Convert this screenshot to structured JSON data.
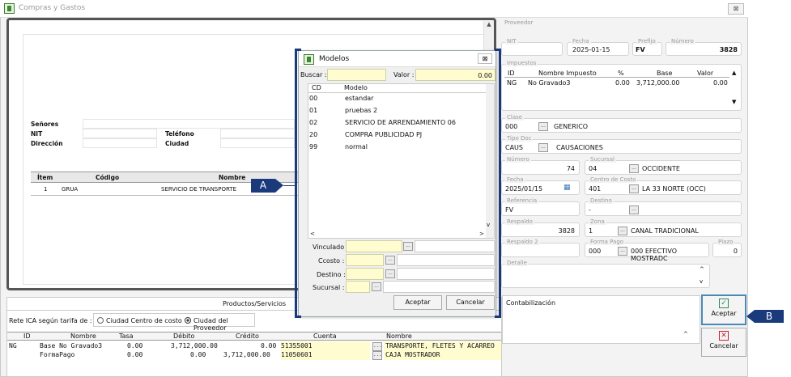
{
  "window": {
    "title": "Compras y Gastos",
    "close": "⊠"
  },
  "invoice": {
    "senores_label": "Señores",
    "nit_label": "NIT",
    "direccion_label": "Dirección",
    "telefono_label": "Teléfono",
    "ciudad_label": "Ciudad",
    "table_headers": [
      "Ítem",
      "Código",
      "Nombre"
    ],
    "rows": [
      {
        "item": "1",
        "codigo": "GRUA",
        "nombre": "SERVICIO DE TRANSPORTE"
      }
    ]
  },
  "proveedor": {
    "legend": "Proveedor",
    "nit_label": "NIT",
    "fecha_label": "Fecha",
    "fecha": "2025-01-15",
    "prefijo_label": "Prefijo",
    "prefijo": "FV",
    "numero_label": "Número",
    "numero": "3828"
  },
  "impuestos": {
    "legend": "Impuestos",
    "headers": [
      "ID",
      "Nombre Impuesto",
      "%",
      "Base",
      "Valor"
    ],
    "rows": [
      {
        "id": "NG",
        "nombre": "No Gravado3",
        "pct": "0.00",
        "base": "3,712,000.00",
        "valor": "0.00"
      }
    ]
  },
  "clase": {
    "legend": "Clase",
    "code": "000",
    "name": "GENERICO"
  },
  "tipo_doc": {
    "legend": "Tipo Doc",
    "code": "CAUS",
    "name": "CAUSACIONES"
  },
  "numero": {
    "legend": "Número",
    "value": "74"
  },
  "sucursal": {
    "legend": "Sucursal",
    "code": "04",
    "name": "OCCIDENTE"
  },
  "fecha": {
    "legend": "Fecha",
    "value": "2025/01/15"
  },
  "centro_costo": {
    "legend": "Centro de Costo",
    "code": "401",
    "name": "LA 33 NORTE (OCC)"
  },
  "referencia": {
    "legend": "Referencia",
    "value": "FV"
  },
  "destino": {
    "legend": "Destino",
    "value": "-"
  },
  "respaldo": {
    "legend": "Respaldo",
    "value": "3828"
  },
  "zona": {
    "legend": "Zona",
    "code": "1",
    "name": "CANAL TRADICIONAL"
  },
  "respaldo2": {
    "legend": "Respaldo 2"
  },
  "forma_pago": {
    "legend": "Forma Pago",
    "code": "000",
    "name": "000 EFECTIVO MOSTRADC"
  },
  "plazo": {
    "legend": "Plazo",
    "value": "0"
  },
  "detalle": {
    "legend": "Detalle"
  },
  "contabilizacion": "Contabilización",
  "buttons": {
    "aceptar": "Aceptar",
    "cancelar": "Cancelar"
  },
  "callouts": {
    "a": "A",
    "b": "B"
  },
  "modal": {
    "title": "Modelos",
    "close": "⊠",
    "buscar_label": "Buscar :",
    "valor_label": "Valor :",
    "valor": "0.00",
    "headers": [
      "CD",
      "Modelo"
    ],
    "rows": [
      {
        "cd": "00",
        "modelo": "estandar"
      },
      {
        "cd": "01",
        "modelo": "pruebas 2"
      },
      {
        "cd": "02",
        "modelo": "SERVICIO DE ARRENDAMIENTO 06"
      },
      {
        "cd": "20",
        "modelo": "COMPRA PUBLICIDAD PJ"
      },
      {
        "cd": "99",
        "modelo": "normal"
      }
    ],
    "vinculado": "Vinculado :",
    "ccosto": "Ccosto :",
    "destino": "Destino :",
    "sucursal": "Sucursal :",
    "aceptar": "Aceptar",
    "cancelar": "Cancelar"
  },
  "productos": {
    "tab": "Productos/Servicios",
    "rete_label": "Rete ICA según tarifa de :",
    "opt1": "Ciudad Centro de costo",
    "opt2": "Ciudad del Proveedor",
    "headers": [
      "ID",
      "Nombre",
      "Tasa",
      "Débito",
      "Crédito",
      "Cuenta",
      "Nombre"
    ],
    "rows": [
      {
        "id": "NG",
        "nombre": "Base No Gravado3",
        "tasa": "0.00",
        "debito": "3,712,000.00",
        "credito": "0.00",
        "cuenta": "51355001",
        "cnombre": "TRANSPORTE, FLETES Y ACARREO"
      },
      {
        "id": "",
        "nombre": "FormaPago",
        "tasa": "0.00",
        "debito": "0.00",
        "credito": "3,712,000.00",
        "cuenta": "11050601",
        "cnombre": "CAJA MOSTRADOR"
      }
    ]
  },
  "colors": {
    "callout": "#1a3a7c",
    "highlight": "#fffccf",
    "accept": "#2e8b57",
    "cancel": "#cc2233"
  }
}
